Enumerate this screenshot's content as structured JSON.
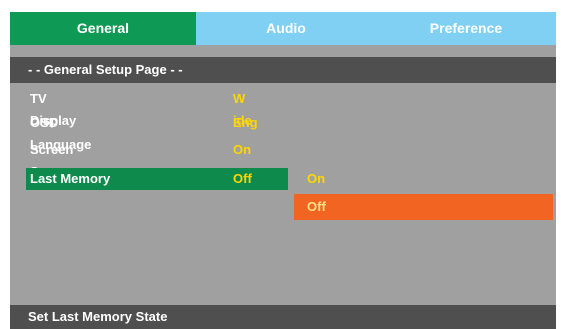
{
  "tabs": [
    {
      "label": "General",
      "active": true
    },
    {
      "label": "Audio",
      "active": false
    },
    {
      "label": "Preference",
      "active": false
    }
  ],
  "page_header": "- - General Setup Page - -",
  "settings": [
    {
      "label": "TV Display",
      "value": "W ide"
    },
    {
      "label": "OSD Language",
      "value": "Eng"
    },
    {
      "label": "Screen Saver",
      "value": "On"
    },
    {
      "label": "Last Memory",
      "value": "Off",
      "selected": true
    }
  ],
  "submenu": {
    "options": [
      "On",
      "Off"
    ],
    "highlighted": "Off"
  },
  "status_text": "Set Last Memory State",
  "colors": {
    "active_tab": "#0e9a55",
    "tab_bar": "#7fd0f2",
    "panel": "#a0a0a0",
    "header": "#4f4f4f",
    "value_text": "#ffd600",
    "submenu_highlight": "#f26422"
  }
}
